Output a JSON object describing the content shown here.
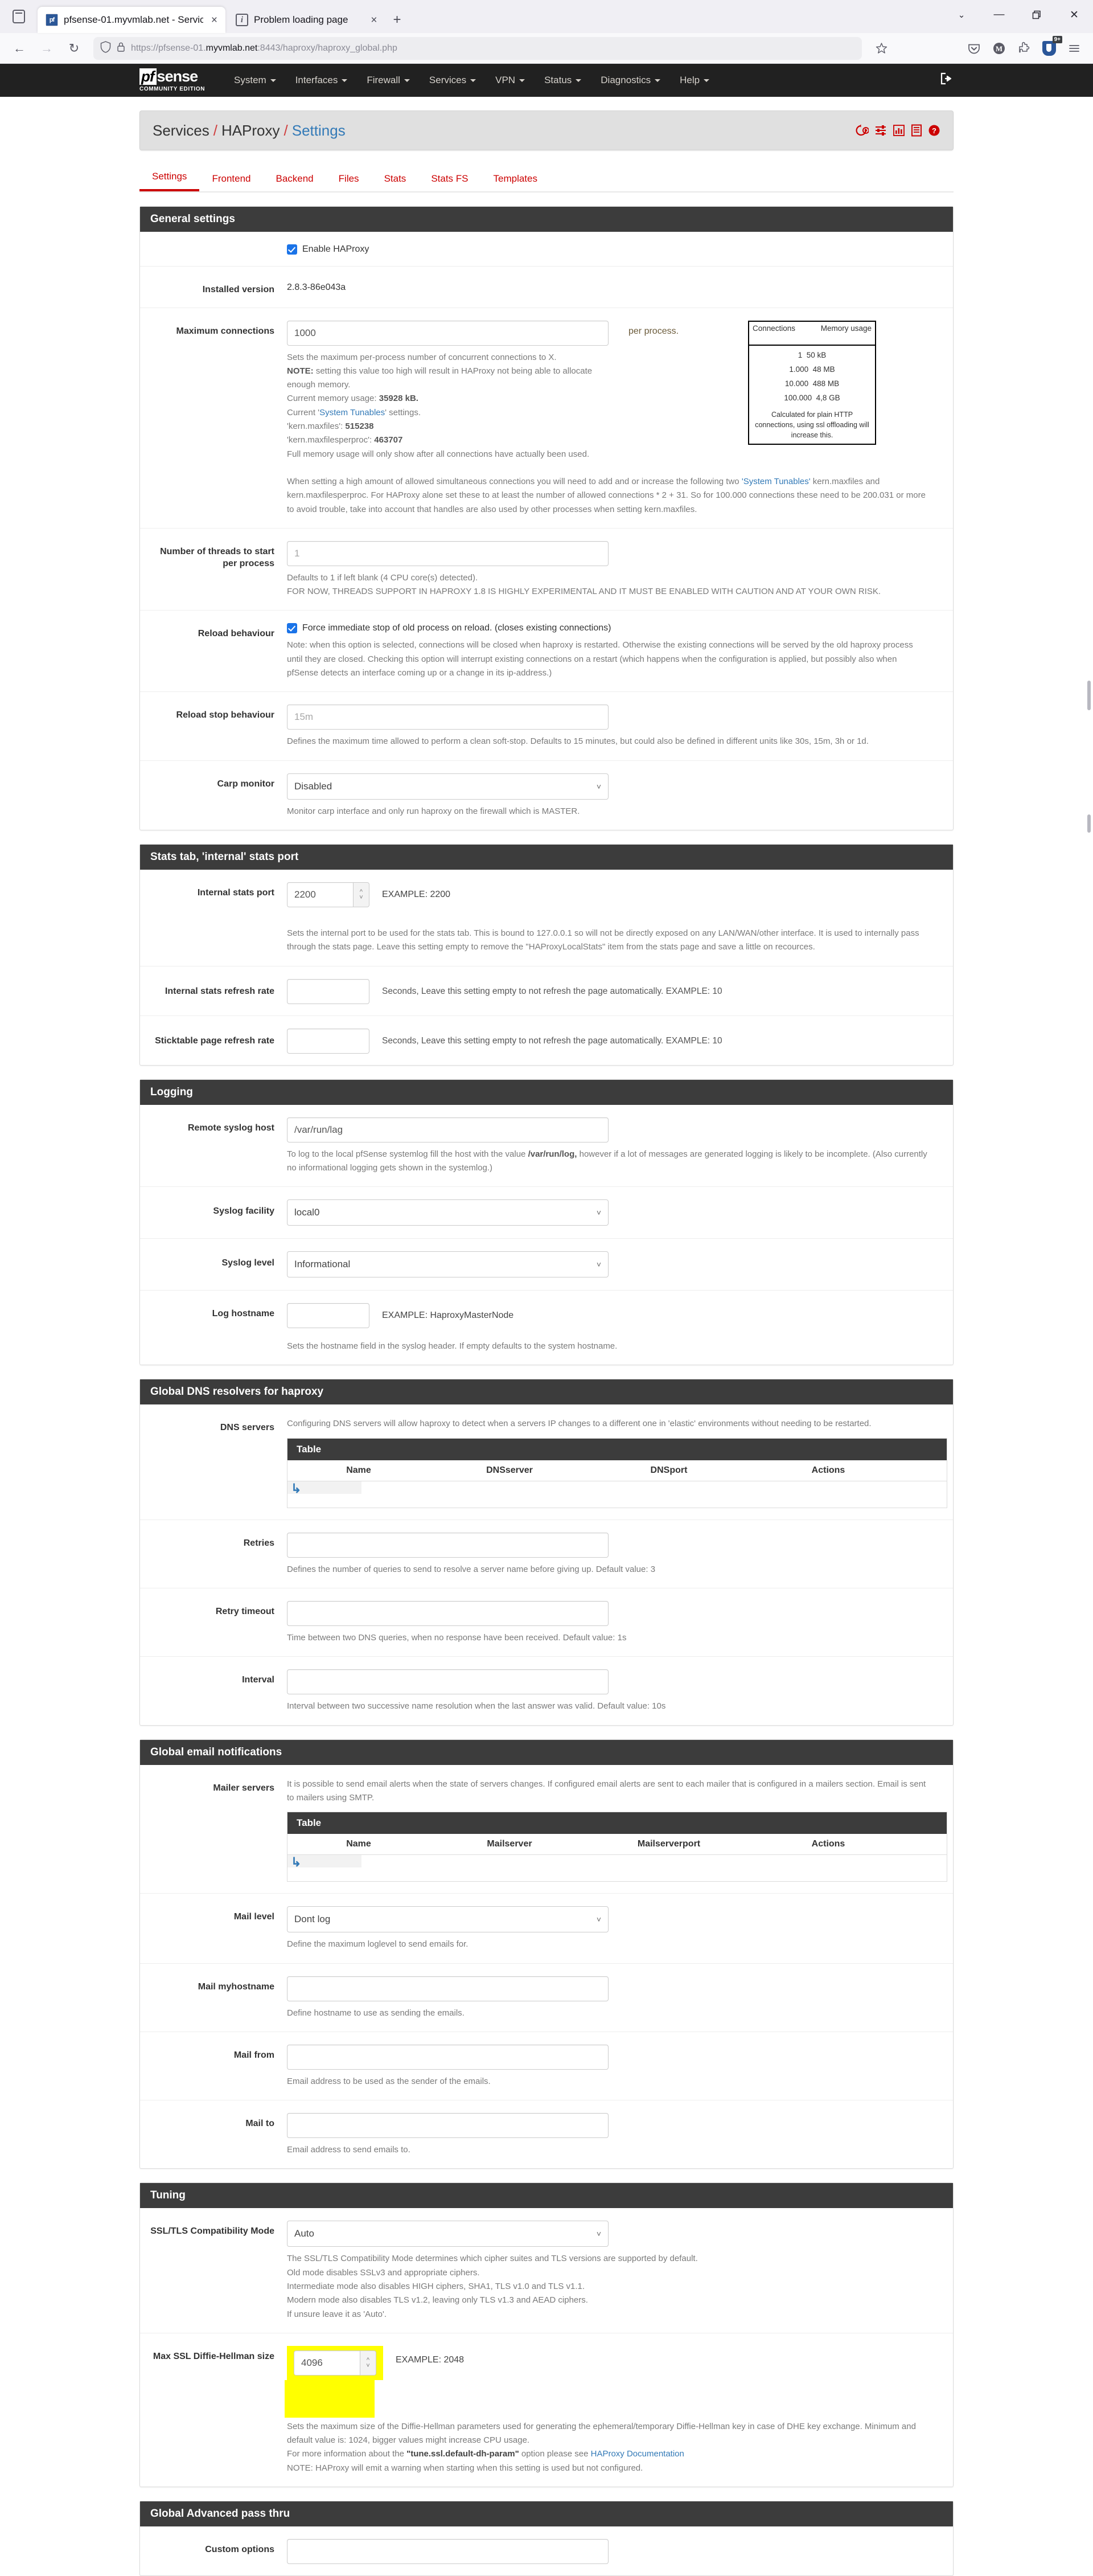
{
  "browser": {
    "tabs": [
      {
        "title": "pfsense-01.myvmlab.net - Servic",
        "favicon": "pfsense-icon",
        "active": true,
        "close_label": "×"
      },
      {
        "title": "Problem loading page",
        "favicon": "info-circle-icon",
        "active": false,
        "close_label": "×"
      }
    ],
    "new_tab_label": "+",
    "window_controls": {
      "list_all_tabs": "⌄",
      "minimize": "—",
      "maximize": "❐",
      "close": "✕"
    },
    "nav": {
      "back": "←",
      "forward": "→",
      "reload": "↻"
    },
    "url": {
      "prefix": "https://pfsense-01.",
      "host_bold": "myvmlab.net",
      "suffix": ":8443/haproxy/haproxy_global.php"
    },
    "toolbar_icons": [
      "pocket-icon",
      "account-icon",
      "extensions-icon",
      "ublock-origin-icon",
      "app-menu-icon"
    ],
    "ublock_badge": "9+"
  },
  "pfsense_nav": {
    "logo_mark": "pf",
    "logo_text": "sense",
    "logo_sub": "COMMUNITY EDITION",
    "menu": [
      "System",
      "Interfaces",
      "Firewall",
      "Services",
      "VPN",
      "Status",
      "Diagnostics",
      "Help"
    ],
    "logout_icon": "logout-icon"
  },
  "breadcrumb": {
    "part1": "Services",
    "part2": "HAProxy",
    "current": "Settings",
    "icons": [
      "restart-service-icon",
      "sliders-icon",
      "stats-chart-icon",
      "logs-icon",
      "help-icon"
    ]
  },
  "tabs": [
    {
      "label": "Settings",
      "active": true
    },
    {
      "label": "Frontend",
      "active": false
    },
    {
      "label": "Backend",
      "active": false
    },
    {
      "label": "Files",
      "active": false
    },
    {
      "label": "Stats",
      "active": false
    },
    {
      "label": "Stats FS",
      "active": false
    },
    {
      "label": "Templates",
      "active": false
    }
  ],
  "general": {
    "heading": "General settings",
    "enable_label": "Enable HAProxy",
    "enable_checked": true,
    "installed_version_label": "Installed version",
    "installed_version_value": "2.8.3-86e043a",
    "maxconn_label": "Maximum connections",
    "maxconn_value": "1000",
    "per_process": "per process.",
    "maxconn_help_1": "Sets the maximum per-process number of concurrent connections to X.",
    "maxconn_help_note_bold": "NOTE:",
    "maxconn_help_note": " setting this value too high will result in HAProxy not being able to allocate enough memory.",
    "mem_usage_prefix": "Current memory usage: ",
    "mem_usage_value": "35928 kB.",
    "tunables_prefix": "Current '",
    "tunables_link": "System Tunables",
    "tunables_suffix": "' settings.",
    "maxfiles_key": "'kern.maxfiles': ",
    "maxfiles_value": "515238",
    "maxfilesperproc_key": "'kern.maxfilesperproc': ",
    "maxfilesperproc_value": "463707",
    "full_mem_note": "Full memory usage will only show after all connections have actually been used.",
    "long_note_1": "When setting a high amount of allowed simultaneous connections you will need to add and or increase the following two ",
    "long_note_link": "'System Tunables'",
    "long_note_2": " kern.maxfiles and kern.maxfilesperproc. For HAProxy alone set these to at least the number of allowed connections * 2 + 31. So for 100.000 connections these need to be 200.031 or more to avoid trouble, take into account that handles are also used by other processes when setting kern.maxfiles.",
    "memtable": {
      "col1": "Connections",
      "col2": "Memory usage",
      "rows": [
        {
          "connections": "1",
          "memory": "50 kB"
        },
        {
          "connections": "1.000",
          "memory": "48 MB"
        },
        {
          "connections": "10.000",
          "memory": "488 MB"
        },
        {
          "connections": "100.000",
          "memory": "4,8 GB"
        }
      ],
      "note": "Calculated for plain HTTP connections, using ssl offloading will increase this."
    },
    "threads_label": "Number of threads to start per process",
    "threads_placeholder": "1",
    "threads_help_1": "Defaults to 1 if left blank (4 CPU core(s) detected).",
    "threads_help_2": "FOR NOW, THREADS SUPPORT IN HAPROXY 1.8 IS HIGHLY EXPERIMENTAL AND IT MUST BE ENABLED WITH CAUTION AND AT YOUR OWN RISK.",
    "reload_label": "Reload behaviour",
    "reload_checkbox_label": "Force immediate stop of old process on reload. (closes existing connections)",
    "reload_checked": true,
    "reload_help": "Note: when this option is selected, connections will be closed when haproxy is restarted. Otherwise the existing connections will be served by the old haproxy process until they are closed. Checking this option will interrupt existing connections on a restart (which happens when the configuration is applied, but possibly also when pfSense detects an interface coming up or a change in its ip-address.)",
    "reload_stop_label": "Reload stop behaviour",
    "reload_stop_placeholder": "15m",
    "reload_stop_help": "Defines the maximum time allowed to perform a clean soft-stop. Defaults to 15 minutes, but could also be defined in different units like 30s, 15m, 3h or 1d.",
    "carp_label": "Carp monitor",
    "carp_value": "Disabled",
    "carp_help": "Monitor carp interface and only run haproxy on the firewall which is MASTER."
  },
  "stats_section": {
    "heading": "Stats tab, 'internal' stats port",
    "internal_port_label": "Internal stats port",
    "internal_port_value": "2200",
    "internal_port_example": "EXAMPLE: 2200",
    "internal_port_help": "Sets the internal port to be used for the stats tab. This is bound to 127.0.0.1 so will not be directly exposed on any LAN/WAN/other interface. It is used to internally pass through the stats page. Leave this setting empty to remove the \"HAProxyLocalStats\" item from the stats page and save a little on recources.",
    "refresh_label": "Internal stats refresh rate",
    "refresh_value": "",
    "refresh_help": "Seconds, Leave this setting empty to not refresh the page automatically. EXAMPLE: 10",
    "sticktable_label": "Sticktable page refresh rate",
    "sticktable_value": "",
    "sticktable_help": "Seconds, Leave this setting empty to not refresh the page automatically. EXAMPLE: 10"
  },
  "logging": {
    "heading": "Logging",
    "remote_syslog_label": "Remote syslog host",
    "remote_syslog_value": "/var/run/lag",
    "remote_syslog_help_1": "To log to the local pfSense systemlog fill the host with the value ",
    "remote_syslog_help_bold": "/var/run/log,",
    "remote_syslog_help_2": " however if a lot of messages are generated logging is likely to be incomplete. (Also currently no informational logging gets shown in the systemlog.)",
    "facility_label": "Syslog facility",
    "facility_value": "local0",
    "level_label": "Syslog level",
    "level_value": "Informational",
    "hostname_label": "Log hostname",
    "hostname_value": "",
    "hostname_example": "EXAMPLE: HaproxyMasterNode",
    "hostname_help": "Sets the hostname field in the syslog header. If empty defaults to the system hostname."
  },
  "dns": {
    "heading": "Global DNS resolvers for haproxy",
    "servers_label": "DNS servers",
    "servers_help": "Configuring DNS servers will allow haproxy to detect when a servers IP changes to a different one in 'elastic' environments without needing to be restarted.",
    "table_title": "Table",
    "columns": [
      "Name",
      "DNSserver",
      "DNSport",
      "Actions"
    ],
    "rows": [],
    "add_icon": "add-row-arrow-icon",
    "retries_label": "Retries",
    "retries_value": "",
    "retries_help": "Defines the number of queries to send to resolve a server name before giving up. Default value: 3",
    "retry_timeout_label": "Retry timeout",
    "retry_timeout_value": "",
    "retry_timeout_help": "Time between two DNS queries, when no response have been received. Default value: 1s",
    "interval_label": "Interval",
    "interval_value": "",
    "interval_help": "Interval between two successive name resolution when the last answer was valid. Default value: 10s"
  },
  "email": {
    "heading": "Global email notifications",
    "mailer_label": "Mailer servers",
    "mailer_help": "It is possible to send email alerts when the state of servers changes. If configured email alerts are sent to each mailer that is configured in a mailers section. Email is sent to mailers using SMTP.",
    "table_title": "Table",
    "columns": [
      "Name",
      "Mailserver",
      "Mailserverport",
      "Actions"
    ],
    "rows": [],
    "add_icon": "add-row-arrow-icon",
    "mail_level_label": "Mail level",
    "mail_level_value": "Dont log",
    "mail_level_help": "Define the maximum loglevel to send emails for.",
    "mail_myhostname_label": "Mail myhostname",
    "mail_myhostname_value": "",
    "mail_myhostname_help": "Define hostname to use as sending the emails.",
    "mail_from_label": "Mail from",
    "mail_from_value": "",
    "mail_from_help": "Email address to be used as the sender of the emails.",
    "mail_to_label": "Mail to",
    "mail_to_value": "",
    "mail_to_help": "Email address to send emails to."
  },
  "tuning": {
    "heading": "Tuning",
    "ssl_mode_label": "SSL/TLS Compatibility Mode",
    "ssl_mode_value": "Auto",
    "ssl_help_1": "The SSL/TLS Compatibility Mode determines which cipher suites and TLS versions are supported by default.",
    "ssl_help_2": "Old mode disables SSLv3 and appropriate ciphers.",
    "ssl_help_3": "Intermediate mode also disables HIGH ciphers, SHA1, TLS v1.0 and TLS v1.1.",
    "ssl_help_4": "Modern mode also disables TLS v1.2, leaving only TLS v1.3 and AEAD ciphers.",
    "ssl_help_5": "If unsure leave it as 'Auto'.",
    "dh_label": "Max SSL Diffie-Hellman size",
    "dh_value": "4096",
    "dh_example": "EXAMPLE: 2048",
    "dh_highlighted": true,
    "dh_help_1": "Sets the maximum size of the Diffie-Hellman parameters used for generating the ephemeral/temporary Diffie-Hellman key in case of DHE key exchange. Minimum and default value is: 1024, bigger values might increase CPU usage.",
    "dh_help_2_prefix": "For more information about the ",
    "dh_help_2_bold": "\"tune.ssl.default-dh-param\"",
    "dh_help_2_mid": " option please see ",
    "dh_help_2_link": "HAProxy Documentation",
    "dh_help_3": "NOTE: HAProxy will emit a warning when starting when this setting is used but not configured."
  },
  "advanced": {
    "heading": "Global Advanced pass thru",
    "custom_options_label": "Custom options",
    "custom_options_value": ""
  },
  "colors": {
    "pf_navbar": "#212121",
    "panel_header": "#3c3c3c",
    "accent_red": "#cc0000",
    "link_blue": "#337ab7",
    "highlight_yellow": "#ffff00",
    "checkbox_blue": "#1a73e8"
  }
}
